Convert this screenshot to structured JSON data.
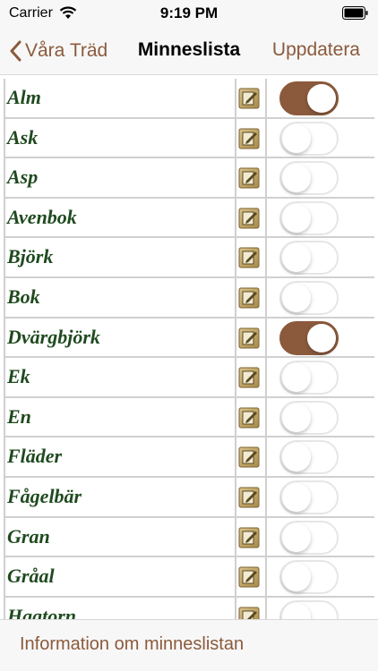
{
  "status_bar": {
    "carrier": "Carrier",
    "time": "9:19 PM"
  },
  "nav": {
    "back_label": "Våra Träd",
    "title": "Minneslista",
    "action_label": "Uppdatera"
  },
  "colors": {
    "accent": "#8b5a3c",
    "tree_name": "#1f4a1f",
    "grid": "#d0d0d0"
  },
  "trees": [
    {
      "name": "Alm",
      "selected": true
    },
    {
      "name": "Ask",
      "selected": false
    },
    {
      "name": "Asp",
      "selected": false
    },
    {
      "name": "Avenbok",
      "selected": false
    },
    {
      "name": "Björk",
      "selected": false
    },
    {
      "name": "Bok",
      "selected": false
    },
    {
      "name": "Dvärgbjörk",
      "selected": true
    },
    {
      "name": "Ek",
      "selected": false
    },
    {
      "name": "En",
      "selected": false
    },
    {
      "name": "Fläder",
      "selected": false
    },
    {
      "name": "Fågelbär",
      "selected": false
    },
    {
      "name": "Gran",
      "selected": false
    },
    {
      "name": "Gråal",
      "selected": false
    },
    {
      "name": "Hagtorn",
      "selected": false
    }
  ],
  "footer": {
    "info_link": "Information om minneslistan"
  }
}
